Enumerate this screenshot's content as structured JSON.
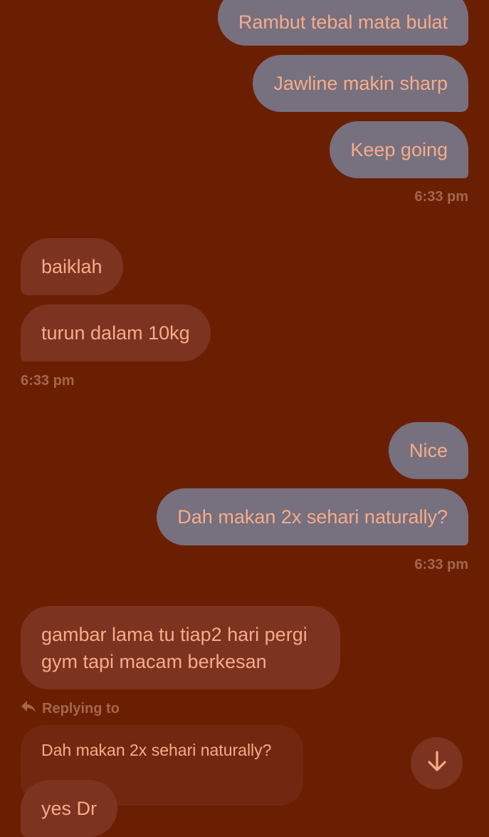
{
  "messages": {
    "m1": "Rambut tebal mata bulat",
    "m2": "Jawline makin sharp",
    "m3": "Keep going",
    "t1": "6:33 pm",
    "m4": "baiklah",
    "m5": "turun dalam 10kg",
    "t2": "6:33 pm",
    "m6": "Nice",
    "m7": "Dah makan 2x sehari naturally?",
    "t3": "6:33 pm",
    "m8_line1": "gambar lama tu tiap2 hari pergi",
    "m8_line2": "gym tapi macam berkesan",
    "reply_label": "Replying to",
    "quoted_text": "Dah makan 2x sehari naturally?",
    "m9": "yes Dr"
  },
  "colors": {
    "background": "#6b1f02",
    "outgoing_bubble": "#77707e",
    "incoming_bubble": "#7c3320",
    "text": "#f6ac8a",
    "muted": "#a4654d"
  },
  "icons": {
    "reply": "reply-arrow-icon",
    "scroll": "arrow-down-icon"
  }
}
